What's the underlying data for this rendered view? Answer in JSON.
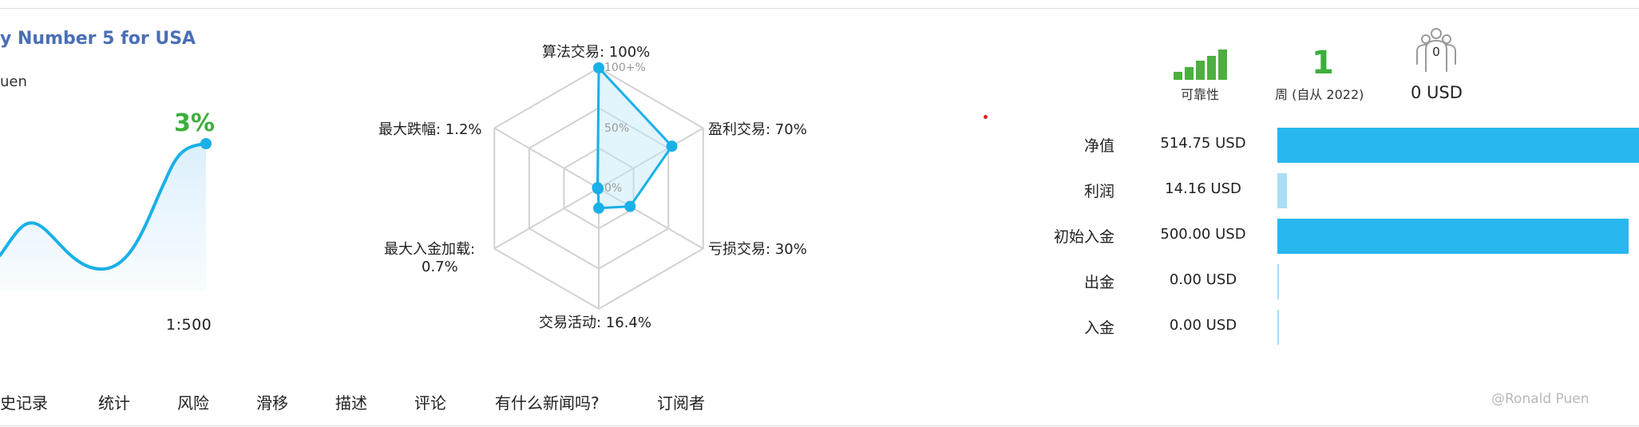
{
  "header": {
    "title": "y Number 5 for USA",
    "author": "uen"
  },
  "growth": {
    "value": "3%",
    "leverage": "1:500"
  },
  "radar": {
    "labels": {
      "algo": "算法交易: 100%",
      "profit": "盈利交易: 70%",
      "loss": "亏损交易: 30%",
      "activity": "交易活动: 16.4%",
      "load_line1": "最大入金加载:",
      "load_line2": "0.7%",
      "drawdown": "最大跌幅: 1.2%"
    },
    "scale": {
      "p100": "100+%",
      "p50": "50%",
      "p0": "0%"
    },
    "values": {
      "algo": 100,
      "profit": 70,
      "loss": 30,
      "activity": 16.4,
      "load": 0.7,
      "drawdown": 1.2
    }
  },
  "summary": {
    "reliability_label": "可靠性",
    "reliability_bars": 5,
    "weeks_value": "1",
    "weeks_label": "周 (自从 2022)",
    "subscribers_icon": "people-icon",
    "subscribers_count": "0",
    "subscribers_funds": "0 USD"
  },
  "stats": [
    {
      "label": "净值",
      "value": "514.75 USD",
      "fraction": 1.0,
      "color": "#28b7ee"
    },
    {
      "label": "利润",
      "value": "14.16 USD",
      "fraction": 0.027,
      "color": "#a9dff6"
    },
    {
      "label": "初始入金",
      "value": "500.00 USD",
      "fraction": 0.971,
      "color": "#28b7ee"
    },
    {
      "label": "出金",
      "value": "0.00 USD",
      "fraction": 0.0,
      "color": "#a9dff6"
    },
    {
      "label": "入金",
      "value": "0.00 USD",
      "fraction": 0.0,
      "color": "#a9dff6"
    }
  ],
  "tabs": [
    "史记录",
    "统计",
    "风险",
    "滑移",
    "描述",
    "评论",
    "有什么新闻吗?",
    "订阅者"
  ],
  "watermark": "@Ronald Puen"
}
